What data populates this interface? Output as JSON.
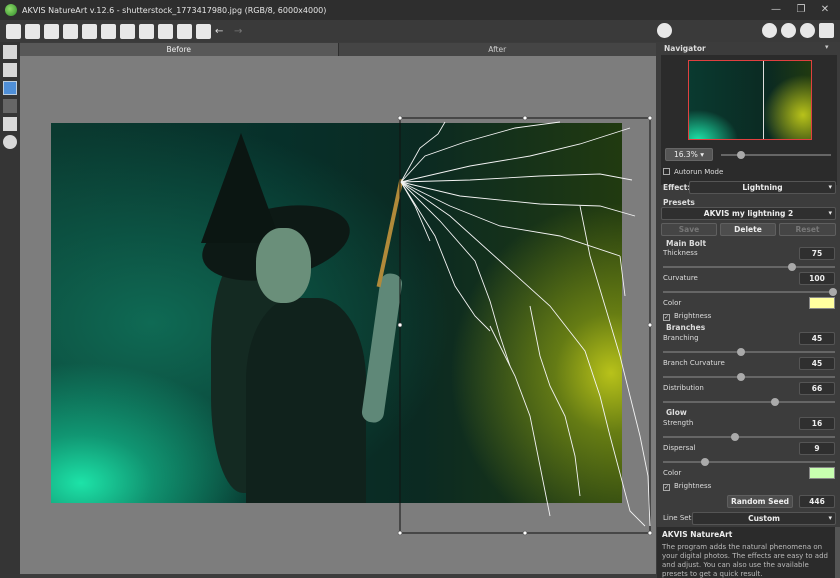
{
  "window": {
    "title": "AKVIS NatureArt v.12.6 - shutterstock_1773417980.jpg (RGB/8, 6000x4000)",
    "min": "—",
    "max": "❐",
    "close": "✕"
  },
  "tabs": {
    "before": "Before",
    "after": "After"
  },
  "navigator": {
    "title": "Navigator",
    "zoom": "16.3%",
    "zoom_arrow": "▾",
    "collapse": "▾"
  },
  "autorun": {
    "label": "Autorun Mode",
    "checked": false
  },
  "effect": {
    "label": "Effect:",
    "value": "Lightning"
  },
  "presets": {
    "label": "Presets",
    "value": "AKVIS my lightning 2",
    "save": "Save",
    "delete": "Delete",
    "reset": "Reset"
  },
  "main_bolt": {
    "title": "Main Bolt",
    "thickness_label": "Thickness",
    "thickness": "75",
    "curvature_label": "Curvature",
    "curvature": "100",
    "color_label": "Color",
    "color": "#ffffa0",
    "brightness_label": "Brightness"
  },
  "branches": {
    "title": "Branches",
    "branching_label": "Branching",
    "branching": "45",
    "branch_curvature_label": "Branch Curvature",
    "branch_curvature": "45",
    "distribution_label": "Distribution",
    "distribution": "66"
  },
  "glow": {
    "title": "Glow",
    "strength_label": "Strength",
    "strength": "16",
    "dispersal_label": "Dispersal",
    "dispersal": "9",
    "color_label": "Color",
    "color": "#c8ffb0",
    "brightness_label": "Brightness"
  },
  "random_seed": {
    "label": "Random Seed",
    "value": "446"
  },
  "line_set": {
    "label": "Line Set",
    "value": "Custom"
  },
  "help": {
    "title": "AKVIS NatureArt",
    "text": "The program adds the natural phenomena on your digital photos. The effects are easy to add and adjust. You can also use the available presets to get a quick result."
  },
  "dropdown_arrow": "▾",
  "check_mark": "✓"
}
